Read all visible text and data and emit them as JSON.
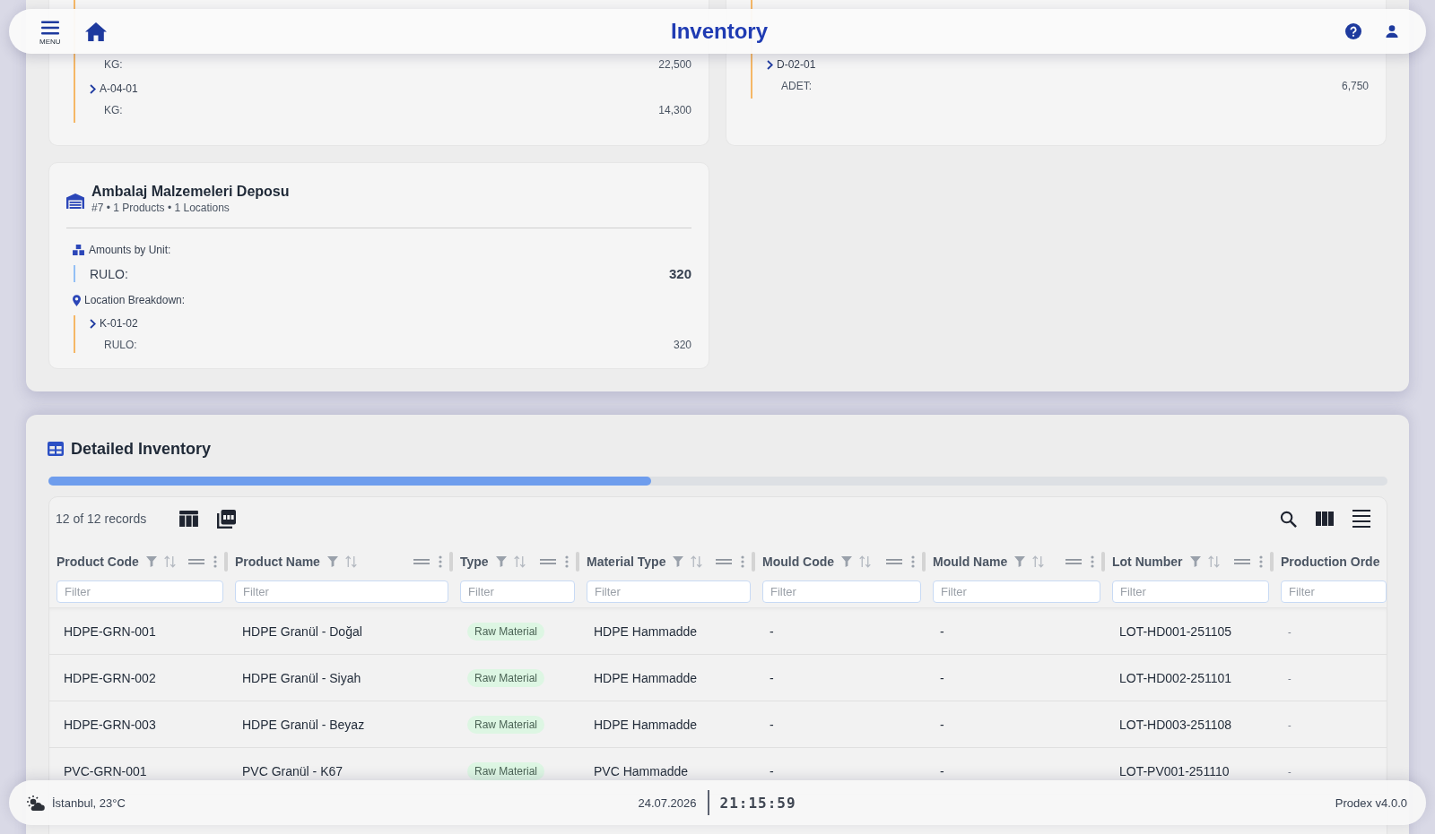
{
  "header": {
    "menu_label": "MENU",
    "title": "Inventory"
  },
  "warehouses": [
    {
      "locations": [
        {
          "amounts": [
            {
              "unit": "KG:",
              "amount": "22,500"
            }
          ]
        },
        {
          "code": "A-04-01",
          "amounts": [
            {
              "unit": "KG:",
              "amount": "14,300"
            }
          ]
        }
      ]
    },
    {
      "locations": [
        {
          "code": "D-02-01",
          "amounts": [
            {
              "unit": "ADET:",
              "amount": "6,750"
            }
          ]
        }
      ]
    },
    {
      "name": "Ambalaj Malzemeleri Deposu",
      "meta": "#7 • 1 Products • 1 Locations",
      "units_label": "Amounts by Unit:",
      "unit_totals": [
        {
          "unit": "RULO:",
          "amount": "320"
        }
      ],
      "locations_label": "Location Breakdown:",
      "locations": [
        {
          "code": "K-01-02",
          "amounts": [
            {
              "unit": "RULO:",
              "amount": "320"
            }
          ]
        }
      ]
    }
  ],
  "detailed_inventory": {
    "title": "Detailed Inventory",
    "records": "12 of 12 records",
    "columns": [
      {
        "label": "Product Code",
        "kind": "text",
        "filter": {
          "placeholder": "Filter"
        }
      },
      {
        "label": "Product Name",
        "kind": "text",
        "filter": {
          "placeholder": "Filter"
        }
      },
      {
        "label": "Type",
        "kind": "badge",
        "filter": {
          "placeholder": "Filter"
        }
      },
      {
        "label": "Material Type",
        "kind": "text",
        "filter": {
          "placeholder": "Filter"
        }
      },
      {
        "label": "Mould Code",
        "kind": "text",
        "filter": {
          "placeholder": "Filter"
        }
      },
      {
        "label": "Mould Name",
        "kind": "text",
        "filter": {
          "placeholder": "Filter"
        }
      },
      {
        "label": "Lot Number",
        "kind": "text",
        "filter": {
          "placeholder": "Filter"
        }
      },
      {
        "label": "Production Orde",
        "kind": "muted",
        "filter": {
          "placeholder": "Filter"
        }
      }
    ],
    "rows": [
      {
        "cells": [
          "HDPE-GRN-001",
          "HDPE Granül - Doğal",
          "Raw Material",
          "HDPE Hammadde",
          "-",
          "-",
          "LOT-HD001-251105",
          "-"
        ]
      },
      {
        "cells": [
          "HDPE-GRN-002",
          "HDPE Granül - Siyah",
          "Raw Material",
          "HDPE Hammadde",
          "-",
          "-",
          "LOT-HD002-251101",
          "-"
        ]
      },
      {
        "cells": [
          "HDPE-GRN-003",
          "HDPE Granül - Beyaz",
          "Raw Material",
          "HDPE Hammadde",
          "-",
          "-",
          "LOT-HD003-251108",
          "-"
        ]
      },
      {
        "cells": [
          "PVC-GRN-001",
          "PVC Granül - K67",
          "Raw Material",
          "PVC Hammadde",
          "-",
          "-",
          "LOT-PV001-251110",
          "-"
        ]
      }
    ]
  },
  "status_bar": {
    "weather": "İstanbul, 23°C",
    "date": "24.07.2026",
    "time": "21:15:59",
    "version": "Prodex v4.0.0"
  }
}
